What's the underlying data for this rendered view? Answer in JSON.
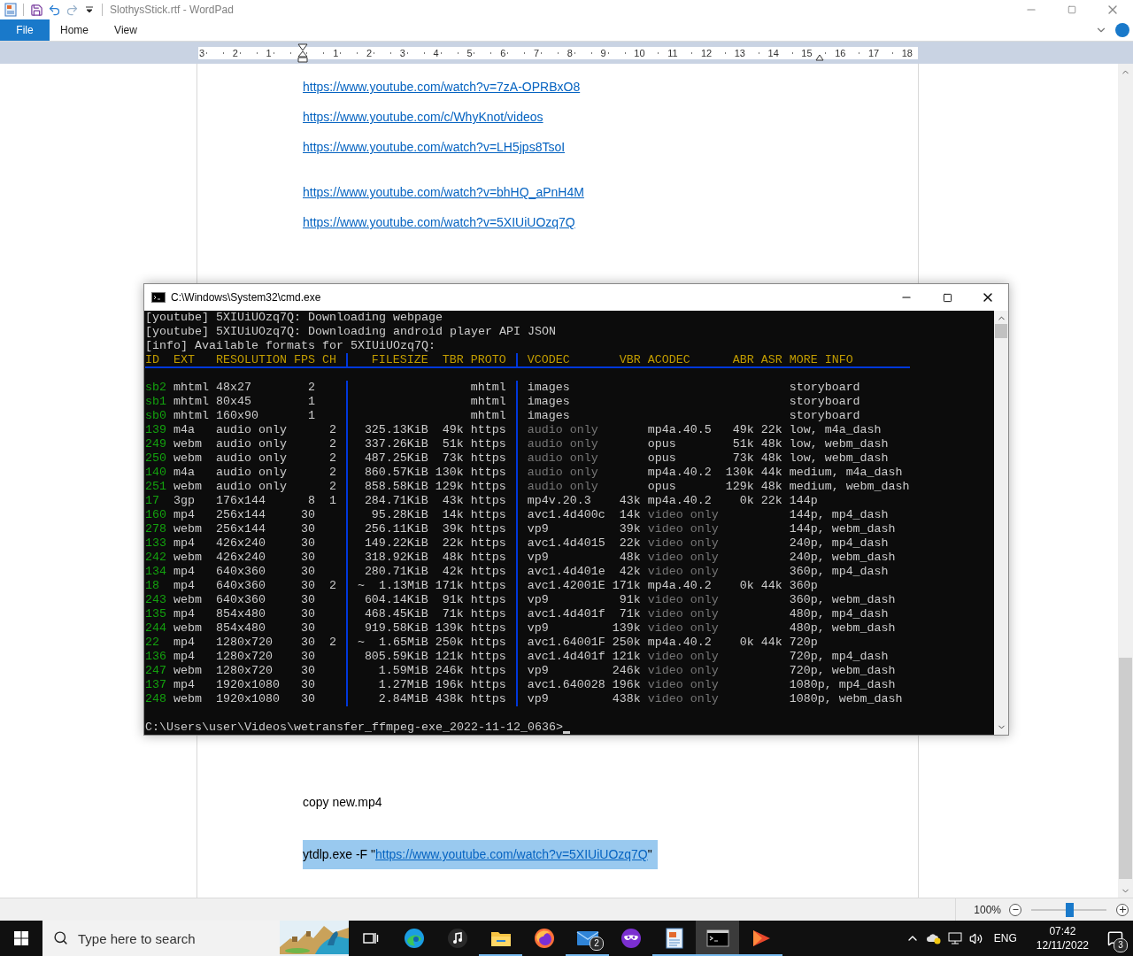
{
  "wordpad": {
    "title": "SlothysStick.rtf - WordPad",
    "ribbon_tabs": [
      {
        "label": "File",
        "kind": "file"
      },
      {
        "label": "Home",
        "kind": "tab"
      },
      {
        "label": "View",
        "kind": "tab"
      }
    ],
    "ruler": {
      "left_labels": [
        "3",
        "2",
        "1"
      ],
      "right_labels": [
        "1",
        "2",
        "3",
        "4",
        "5",
        "6",
        "7",
        "8",
        "9",
        "10",
        "11",
        "12",
        "13",
        "14",
        "15",
        "16",
        "17",
        "18"
      ]
    },
    "document": {
      "sections": [
        {
          "paragraphs": [
            {
              "kind": "link",
              "link": "https://www.youtube.com/watch?v=7zA-OPRBxO8"
            },
            {
              "kind": "link",
              "link": "https://www.youtube.com/c/WhyKnot/videos"
            },
            {
              "kind": "link",
              "link": "https://www.youtube.com/watch?v=LH5jps8TsoI"
            }
          ]
        },
        {
          "paragraphs": [
            {
              "kind": "link",
              "link": "https://www.youtube.com/watch?v=bhHQ_aPnH4M"
            },
            {
              "kind": "link",
              "link": "https://www.youtube.com/watch?v=5XIUiUOzq7Q"
            }
          ]
        },
        {
          "paragraphs": [
            {
              "kind": "text",
              "text": "copy new.mp4"
            }
          ]
        },
        {
          "paragraphs": [
            {
              "kind": "command",
              "prefix": "ytdlp.exe -F \"",
              "link": "https://www.youtube.com/watch?v=5XIUiUOzq7Q",
              "suffix": "\"",
              "selected": true
            }
          ]
        }
      ]
    },
    "status_bar": {
      "zoom": "100%",
      "zoom_slider": {
        "level": 0.5
      }
    }
  },
  "cmd": {
    "title": "C:\\Windows\\System32\\cmd.exe",
    "log_lines": [
      "[youtube] 5XIUiUOzq7Q: Downloading webpage",
      "[youtube] 5XIUiUOzq7Q: Downloading android player API JSON",
      "[info] Available formats for 5XIUiUOzq7Q:"
    ],
    "columns": {
      "id": "ID",
      "ext": "EXT",
      "resolution": "RESOLUTION",
      "fps": "FPS",
      "ch": "CH",
      "filesize": "FILESIZE",
      "tbr": "TBR",
      "proto": "PROTO",
      "vcodec": "VCODEC",
      "vbr": "VBR",
      "acodec": "ACODEC",
      "abr": "ABR",
      "asr": "ASR",
      "more_info": "MORE INFO"
    },
    "formats": [
      {
        "kind": "storyboard",
        "id": "sb2",
        "ext": "mhtml",
        "resolution": "48x27",
        "fps": "2",
        "proto": "mhtml",
        "vcodec": "images",
        "more_info": "storyboard"
      },
      {
        "kind": "storyboard",
        "id": "sb1",
        "ext": "mhtml",
        "resolution": "80x45",
        "fps": "1",
        "proto": "mhtml",
        "vcodec": "images",
        "more_info": "storyboard"
      },
      {
        "kind": "storyboard",
        "id": "sb0",
        "ext": "mhtml",
        "resolution": "160x90",
        "fps": "1",
        "proto": "mhtml",
        "vcodec": "images",
        "more_info": "storyboard"
      },
      {
        "kind": "audio",
        "id": "139",
        "ext": "m4a",
        "resolution": "audio only",
        "ch": "2",
        "filesize": "325.13KiB",
        "tbr": "49k",
        "proto": "https",
        "vcodec": "audio only",
        "acodec": "mp4a.40.5",
        "abr": "49k",
        "asr": "22k",
        "more_info": "low, m4a_dash"
      },
      {
        "kind": "audio",
        "id": "249",
        "ext": "webm",
        "resolution": "audio only",
        "ch": "2",
        "filesize": "337.26KiB",
        "tbr": "51k",
        "proto": "https",
        "vcodec": "audio only",
        "acodec": "opus",
        "abr": "51k",
        "asr": "48k",
        "more_info": "low, webm_dash"
      },
      {
        "kind": "audio",
        "id": "250",
        "ext": "webm",
        "resolution": "audio only",
        "ch": "2",
        "filesize": "487.25KiB",
        "tbr": "73k",
        "proto": "https",
        "vcodec": "audio only",
        "acodec": "opus",
        "abr": "73k",
        "asr": "48k",
        "more_info": "low, webm_dash"
      },
      {
        "kind": "audio",
        "id": "140",
        "ext": "m4a",
        "resolution": "audio only",
        "ch": "2",
        "filesize": "860.57KiB",
        "tbr": "130k",
        "proto": "https",
        "vcodec": "audio only",
        "acodec": "mp4a.40.2",
        "abr": "130k",
        "asr": "44k",
        "more_info": "medium, m4a_dash"
      },
      {
        "kind": "audio",
        "id": "251",
        "ext": "webm",
        "resolution": "audio only",
        "ch": "2",
        "filesize": "858.58KiB",
        "tbr": "129k",
        "proto": "https",
        "vcodec": "audio only",
        "acodec": "opus",
        "abr": "129k",
        "asr": "48k",
        "more_info": "medium, webm_dash"
      },
      {
        "kind": "combined",
        "id": "17",
        "ext": "3gp",
        "resolution": "176x144",
        "fps": "8",
        "ch": "1",
        "filesize": "284.71KiB",
        "tbr": "43k",
        "proto": "https",
        "vcodec": "mp4v.20.3",
        "vbr": "43k",
        "acodec": "mp4a.40.2",
        "abr": "0k",
        "asr": "22k",
        "more_info": "144p"
      },
      {
        "kind": "video",
        "id": "160",
        "ext": "mp4",
        "resolution": "256x144",
        "fps": "30",
        "filesize": "95.28KiB",
        "tbr": "14k",
        "proto": "https",
        "vcodec": "avc1.4d400c",
        "vbr": "14k",
        "acodec": "video only",
        "more_info": "144p, mp4_dash"
      },
      {
        "kind": "video",
        "id": "278",
        "ext": "webm",
        "resolution": "256x144",
        "fps": "30",
        "filesize": "256.11KiB",
        "tbr": "39k",
        "proto": "https",
        "vcodec": "vp9",
        "vbr": "39k",
        "acodec": "video only",
        "more_info": "144p, webm_dash"
      },
      {
        "kind": "video",
        "id": "133",
        "ext": "mp4",
        "resolution": "426x240",
        "fps": "30",
        "filesize": "149.22KiB",
        "tbr": "22k",
        "proto": "https",
        "vcodec": "avc1.4d4015",
        "vbr": "22k",
        "acodec": "video only",
        "more_info": "240p, mp4_dash"
      },
      {
        "kind": "video",
        "id": "242",
        "ext": "webm",
        "resolution": "426x240",
        "fps": "30",
        "filesize": "318.92KiB",
        "tbr": "48k",
        "proto": "https",
        "vcodec": "vp9",
        "vbr": "48k",
        "acodec": "video only",
        "more_info": "240p, webm_dash"
      },
      {
        "kind": "video",
        "id": "134",
        "ext": "mp4",
        "resolution": "640x360",
        "fps": "30",
        "filesize": "280.71KiB",
        "tbr": "42k",
        "proto": "https",
        "vcodec": "avc1.4d401e",
        "vbr": "42k",
        "acodec": "video only",
        "more_info": "360p, mp4_dash"
      },
      {
        "kind": "combined",
        "id": "18",
        "ext": "mp4",
        "resolution": "640x360",
        "fps": "30",
        "ch": "2",
        "filesize": "~  1.13MiB",
        "tbr": "171k",
        "proto": "https",
        "vcodec": "avc1.42001E",
        "vbr": "171k",
        "acodec": "mp4a.40.2",
        "abr": "0k",
        "asr": "44k",
        "more_info": "360p"
      },
      {
        "kind": "video",
        "id": "243",
        "ext": "webm",
        "resolution": "640x360",
        "fps": "30",
        "filesize": "604.14KiB",
        "tbr": "91k",
        "proto": "https",
        "vcodec": "vp9",
        "vbr": "91k",
        "acodec": "video only",
        "more_info": "360p, webm_dash"
      },
      {
        "kind": "video",
        "id": "135",
        "ext": "mp4",
        "resolution": "854x480",
        "fps": "30",
        "filesize": "468.45KiB",
        "tbr": "71k",
        "proto": "https",
        "vcodec": "avc1.4d401f",
        "vbr": "71k",
        "acodec": "video only",
        "more_info": "480p, mp4_dash"
      },
      {
        "kind": "video",
        "id": "244",
        "ext": "webm",
        "resolution": "854x480",
        "fps": "30",
        "filesize": "919.58KiB",
        "tbr": "139k",
        "proto": "https",
        "vcodec": "vp9",
        "vbr": "139k",
        "acodec": "video only",
        "more_info": "480p, webm_dash"
      },
      {
        "kind": "combined",
        "id": "22",
        "ext": "mp4",
        "resolution": "1280x720",
        "fps": "30",
        "ch": "2",
        "filesize": "~  1.65MiB",
        "tbr": "250k",
        "proto": "https",
        "vcodec": "avc1.64001F",
        "vbr": "250k",
        "acodec": "mp4a.40.2",
        "abr": "0k",
        "asr": "44k",
        "more_info": "720p"
      },
      {
        "kind": "video",
        "id": "136",
        "ext": "mp4",
        "resolution": "1280x720",
        "fps": "30",
        "filesize": "805.59KiB",
        "tbr": "121k",
        "proto": "https",
        "vcodec": "avc1.4d401f",
        "vbr": "121k",
        "acodec": "video only",
        "more_info": "720p, mp4_dash"
      },
      {
        "kind": "video",
        "id": "247",
        "ext": "webm",
        "resolution": "1280x720",
        "fps": "30",
        "filesize": "1.59MiB",
        "tbr": "246k",
        "proto": "https",
        "vcodec": "vp9",
        "vbr": "246k",
        "acodec": "video only",
        "more_info": "720p, webm_dash"
      },
      {
        "kind": "video",
        "id": "137",
        "ext": "mp4",
        "resolution": "1920x1080",
        "fps": "30",
        "filesize": "1.27MiB",
        "tbr": "196k",
        "proto": "https",
        "vcodec": "avc1.640028",
        "vbr": "196k",
        "acodec": "video only",
        "more_info": "1080p, mp4_dash"
      },
      {
        "kind": "video",
        "id": "248",
        "ext": "webm",
        "resolution": "1920x1080",
        "fps": "30",
        "filesize": "2.84MiB",
        "tbr": "438k",
        "proto": "https",
        "vcodec": "vp9",
        "vbr": "438k",
        "acodec": "video only",
        "more_info": "1080p, webm_dash"
      }
    ],
    "prompt": "C:\\Users\\user\\Videos\\wetransfer_ffmpeg-exe_2022-11-12_0636>"
  },
  "taskbar": {
    "search_placeholder": "Type here to search",
    "apps": [
      {
        "kind": "taskview",
        "selected": false,
        "running": false
      },
      {
        "kind": "edge",
        "selected": false,
        "running": false
      },
      {
        "kind": "music",
        "selected": false,
        "running": false
      },
      {
        "kind": "explorer",
        "selected": false,
        "running": true
      },
      {
        "kind": "firefox",
        "selected": false,
        "running": false
      },
      {
        "kind": "mail",
        "badge": "2",
        "selected": false,
        "running": true
      },
      {
        "kind": "mask",
        "selected": false,
        "running": false
      },
      {
        "kind": "wordpad",
        "selected": false,
        "running": true
      },
      {
        "kind": "terminal",
        "selected": true,
        "running": true
      },
      {
        "kind": "player",
        "selected": false,
        "running": true
      }
    ],
    "language": "ENG",
    "time": "07:42",
    "date": "12/11/2022",
    "notifications": "3"
  }
}
